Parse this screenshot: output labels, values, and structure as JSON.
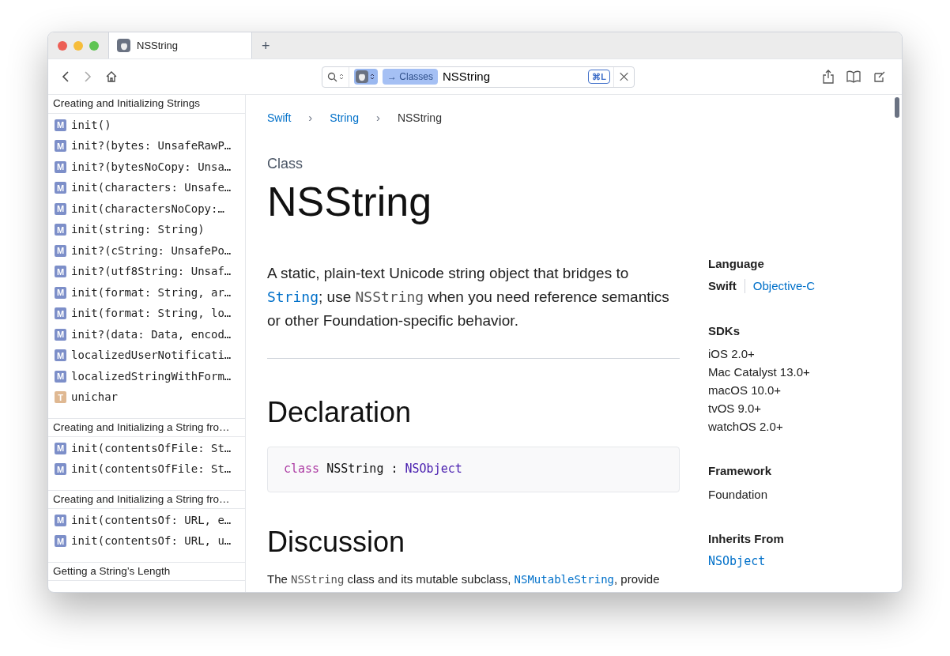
{
  "tabs": [
    {
      "label": "NSString",
      "selected": true
    }
  ],
  "new_tab": "+",
  "search": {
    "token": "→ Classes",
    "query": "NSString",
    "shortcut": "⌘L"
  },
  "sidebar": {
    "sections": [
      {
        "title": "Creating and Initializing Strings",
        "items": [
          {
            "kind": "method",
            "badge": "M",
            "label": "init()"
          },
          {
            "kind": "method",
            "badge": "M",
            "label": "init?(bytes: UnsafeRawP…"
          },
          {
            "kind": "method",
            "badge": "M",
            "label": "init?(bytesNoCopy: Unsa…"
          },
          {
            "kind": "method",
            "badge": "M",
            "label": "init(characters: Unsafe…"
          },
          {
            "kind": "method",
            "badge": "M",
            "label": "init(charactersNoCopy:…"
          },
          {
            "kind": "method",
            "badge": "M",
            "label": "init(string: String)"
          },
          {
            "kind": "method",
            "badge": "M",
            "label": "init?(cString: UnsafePo…"
          },
          {
            "kind": "method",
            "badge": "M",
            "label": "init?(utf8String: Unsaf…"
          },
          {
            "kind": "method",
            "badge": "M",
            "label": "init(format: String, ar…"
          },
          {
            "kind": "method",
            "badge": "M",
            "label": "init(format: String, lo…"
          },
          {
            "kind": "method",
            "badge": "M",
            "label": "init?(data: Data, encod…"
          },
          {
            "kind": "method",
            "badge": "M",
            "label": "localizedUserNotificati…"
          },
          {
            "kind": "method",
            "badge": "M",
            "label": "localizedStringWithForm…"
          },
          {
            "kind": "type",
            "badge": "T",
            "label": "unichar"
          }
        ]
      },
      {
        "title": "Creating and Initializing a String fro…",
        "items": [
          {
            "kind": "method",
            "badge": "M",
            "label": "init(contentsOfFile: St…"
          },
          {
            "kind": "method",
            "badge": "M",
            "label": "init(contentsOfFile: St…"
          }
        ]
      },
      {
        "title": "Creating and Initializing a String fro…",
        "items": [
          {
            "kind": "method",
            "badge": "M",
            "label": "init(contentsOf: URL, e…"
          },
          {
            "kind": "method",
            "badge": "M",
            "label": "init(contentsOf: URL, u…"
          }
        ]
      },
      {
        "title": "Getting a String’s Length"
      }
    ]
  },
  "breadcrumbs": {
    "separator": "›",
    "items": [
      {
        "label": "Swift",
        "kind": "link"
      },
      {
        "label": "String",
        "kind": "link"
      },
      {
        "label": "NSString",
        "kind": "current"
      }
    ]
  },
  "eyebrow": "Class",
  "title": "NSString",
  "abstract": [
    {
      "kind": "text",
      "text": "A static, plain-text Unicode string object that bridges to "
    },
    {
      "kind": "link",
      "text": "String"
    },
    {
      "kind": "text",
      "text": "; use "
    },
    {
      "kind": "code",
      "text": "NSString"
    },
    {
      "kind": "text",
      "text": " when you need reference semantics or other Foundation-specific behavior."
    }
  ],
  "declaration": {
    "heading": "Declaration",
    "tokens": [
      {
        "kind": "keyword",
        "text": "class"
      },
      {
        "kind": "plain",
        "text": " NSString : "
      },
      {
        "kind": "type",
        "text": "NSObject"
      }
    ]
  },
  "discussion": {
    "heading": "Discussion",
    "parts": [
      {
        "kind": "text",
        "text": "The "
      },
      {
        "kind": "code",
        "text": "NSString"
      },
      {
        "kind": "text",
        "text": " class and its mutable subclass, "
      },
      {
        "kind": "link",
        "text": "NSMutableString"
      },
      {
        "kind": "text",
        "text": ", provide"
      }
    ]
  },
  "aside": [
    {
      "heading": "Language",
      "kind": "languages",
      "items": [
        {
          "label": "Swift",
          "selected": true
        },
        {
          "label": "Objective-C",
          "selected": false
        }
      ]
    },
    {
      "heading": "SDKs",
      "kind": "list",
      "items": [
        "iOS 2.0+",
        "Mac Catalyst 13.0+",
        "macOS 10.0+",
        "tvOS 9.0+",
        "watchOS 2.0+"
      ]
    },
    {
      "heading": "Framework",
      "kind": "list",
      "items": [
        "Foundation"
      ]
    },
    {
      "heading": "Inherits From",
      "kind": "links",
      "items": [
        "NSObject"
      ]
    }
  ]
}
